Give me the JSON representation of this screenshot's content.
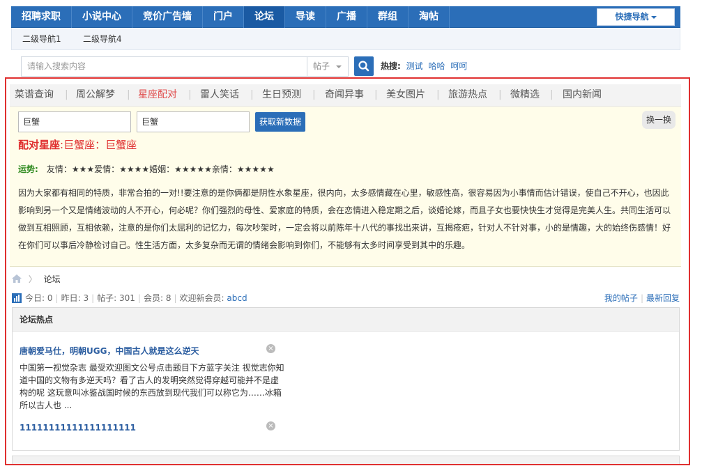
{
  "topnav": {
    "items": [
      {
        "label": "招聘求职"
      },
      {
        "label": "小说中心"
      },
      {
        "label": "竞价广告墙"
      },
      {
        "label": "门户"
      },
      {
        "label": "论坛"
      },
      {
        "label": "导读"
      },
      {
        "label": "广播"
      },
      {
        "label": "群组"
      },
      {
        "label": "淘帖"
      }
    ],
    "active": "论坛",
    "quick_nav": "快捷导航"
  },
  "subnav": {
    "items": [
      {
        "label": "二级导航1"
      },
      {
        "label": "二级导航4"
      }
    ]
  },
  "search": {
    "placeholder": "请输入搜索内容",
    "type": "帖子",
    "hot_label": "热搜:",
    "hot_terms": [
      "测试",
      "哈哈",
      "呵呵"
    ]
  },
  "tabs": {
    "items": [
      {
        "label": "菜谱查询"
      },
      {
        "label": "周公解梦"
      },
      {
        "label": "星座配对"
      },
      {
        "label": "雷人笑话"
      },
      {
        "label": "生日预测"
      },
      {
        "label": "奇闻异事"
      },
      {
        "label": "美女图片"
      },
      {
        "label": "旅游热点"
      },
      {
        "label": "微精选"
      },
      {
        "label": "国内新闻"
      }
    ],
    "active": "星座配对"
  },
  "horoscope": {
    "sign_a": "巨蟹",
    "sign_b": "巨蟹",
    "fetch_label": "获取新数据",
    "swap_label": "换一换",
    "match_prefix": "配对星座",
    "match_value": ":巨蟹座：巨蟹座",
    "fortune_label": "运势:",
    "fortune_text": "友情：★★★爱情：★★★★婚姻：★★★★★亲情：★★★★★",
    "description": "因为大家都有相同的特质，非常合拍的一对!!要注意的是你俩都是阴性水象星座，很内向，太多感情藏在心里，敏感性高，很容易因为小事情而估计错误，使自己不开心，也因此影响到另一个又是情绪波动的人不开心，何必呢？你们强烈的母性、爱家庭的特质，会在恋情进入稳定期之后，谈婚论嫁，而且子女也要快快生才觉得是完美人生。共同生活可以做到互相照顾，互相依赖，注意的是你们太屈利的记忆力，每次吵架时，一定会将以前陈年十八代的事找出来讲，互揭疮疤，针对人不针对事，小的是情趣，大的始终伤感情！好在你们可以事后冷静检讨自己。性生活方面，太多复杂而无谓的情绪会影响到你们，不能够有太多时间享受到其中的乐趣。"
  },
  "breadcrumb": {
    "separator": "〉",
    "current": "论坛"
  },
  "stats": {
    "today_label": "今日:",
    "today": "0",
    "yesterday_label": "昨日:",
    "yesterday": "3",
    "posts_label": "帖子:",
    "posts": "301",
    "members_label": "会员:",
    "members": "8",
    "welcome_label": "欢迎新会员:",
    "new_member": "abcd",
    "my_posts": "我的帖子",
    "latest_reply": "最新回复"
  },
  "forum_hot": {
    "title": "论坛热点",
    "posts": [
      {
        "title": "唐朝爱马仕，明朝UGG，中国古人就是这么逆天",
        "excerpt": "中国第一视觉杂志 最受欢迎图文公号点击题目下方蓝字关注 视觉志你知道中国的文物有多逆天吗？看了古人的发明突然觉得穿越可能并不是虚构的呢 这玩意叫冰鉴战国时候的东西放到现代我们可以称它为……冰箱所以古人也 ..."
      },
      {
        "title": "11111111111111111111",
        "excerpt": ""
      }
    ]
  }
}
